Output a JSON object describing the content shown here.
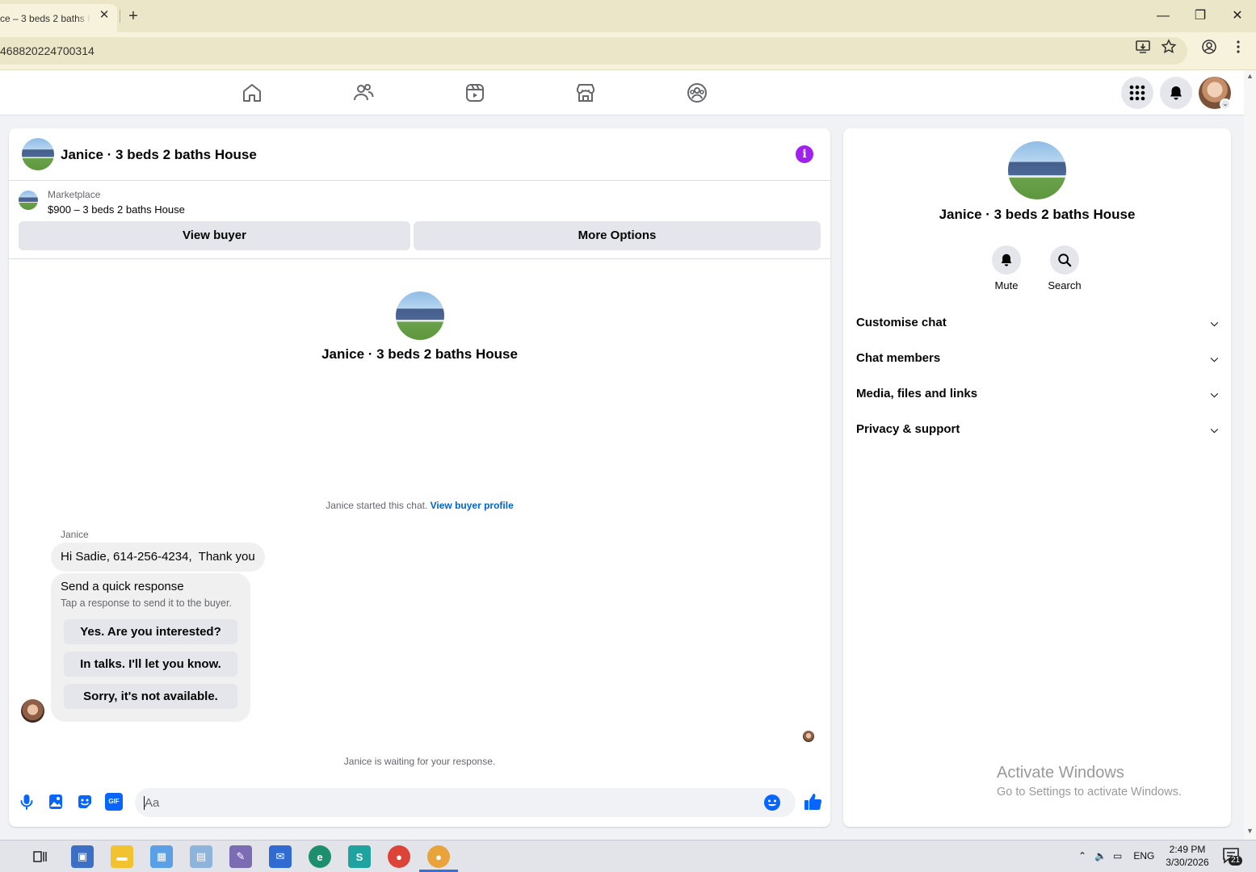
{
  "browser": {
    "tab_title": "ce – 3 beds 2 baths H",
    "tab_close": "✕",
    "new_tab": "+",
    "url": "468820224700314",
    "window_controls": {
      "minimize": "—",
      "restore": "❐",
      "close": "✕"
    }
  },
  "fb_nav": {
    "items": [
      "home-icon",
      "friends-icon",
      "video-icon",
      "marketplace-icon",
      "groups-icon"
    ],
    "right": [
      "menu-grid-icon",
      "notifications-icon",
      "profile-avatar"
    ]
  },
  "chat": {
    "title": "Janice · 3 beds 2 baths House",
    "info_icon": "i",
    "marketplace": {
      "label": "Marketplace",
      "listing": "$900 – 3 beds 2 baths House",
      "view_buyer": "View buyer",
      "more_options": "More Options"
    },
    "center_title": "Janice · 3 beds 2 baths House",
    "started_text": "Janice started this chat. ",
    "view_buyer_profile": "View buyer profile",
    "sender_name": "Janice",
    "message": "Hi Sadie, 614-256-4234,  Thank you",
    "quick_response": {
      "title": "Send a quick response",
      "subtitle": "Tap a response to send it to the buyer.",
      "options": [
        "Yes. Are you interested?",
        "In talks. I'll let you know.",
        "Sorry, it's not available."
      ]
    },
    "waiting_text": "Janice is waiting for your response.",
    "composer_placeholder": "Aa",
    "composer_icons": [
      "microphone-icon",
      "photo-icon",
      "sticker-icon",
      "gif-icon",
      "emoji-icon",
      "thumbs-up-icon"
    ],
    "gif_label": "GIF"
  },
  "right_panel": {
    "title": "Janice · 3 beds 2 baths House",
    "mute_label": "Mute",
    "search_label": "Search",
    "sections": [
      "Customise chat",
      "Chat members",
      "Media, files and links",
      "Privacy & support"
    ]
  },
  "watermark": {
    "line1": "Activate Windows",
    "line2": "Go to Settings to activate Windows."
  },
  "taskbar": {
    "language": "ENG",
    "time": "2:49 PM",
    "date": "3/30/2026",
    "notification_count": "21"
  },
  "colors": {
    "accent": "#0064d1",
    "info": "#a020f0",
    "like": "#0866ff",
    "chrome_bg": "#ece6c8"
  }
}
